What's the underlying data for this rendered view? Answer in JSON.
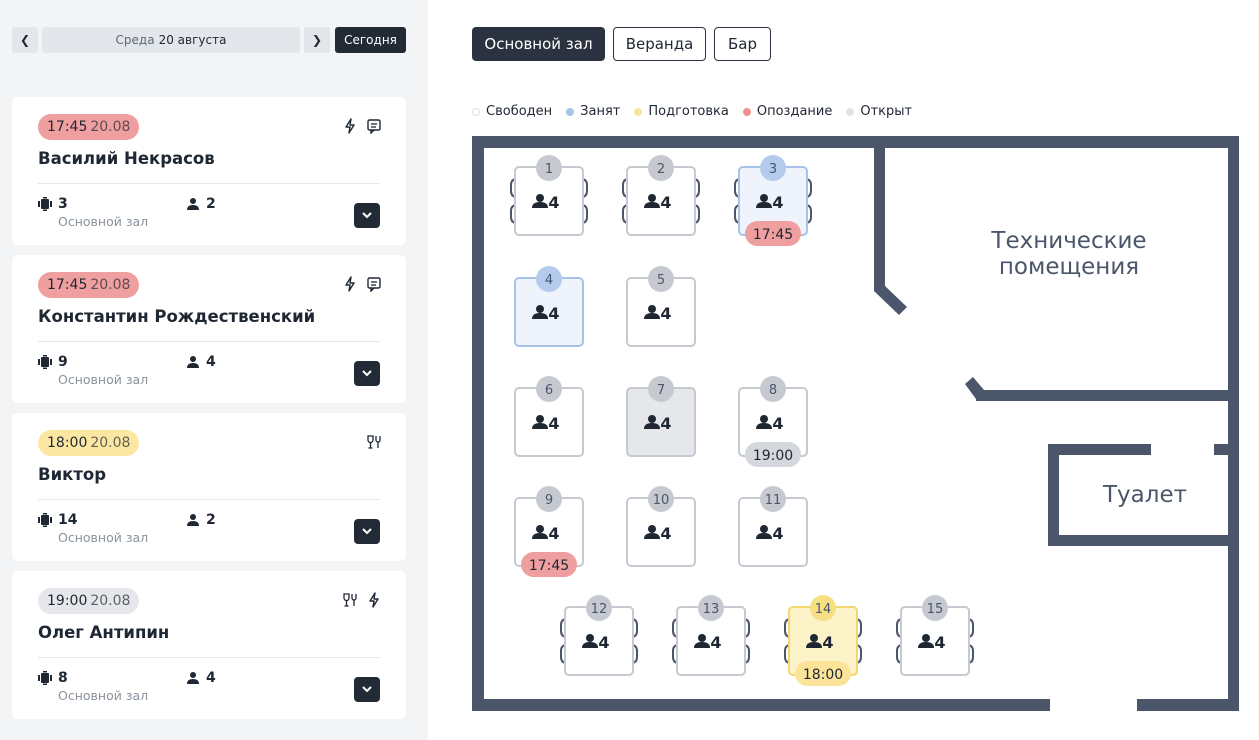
{
  "date_nav": {
    "prev_icon": "chevron-left-icon",
    "weekday": "Среда",
    "date": "20 августа",
    "next_icon": "chevron-right-icon",
    "today_label": "Сегодня"
  },
  "reservations": [
    {
      "time": "17:45",
      "date": "20.08",
      "status": "late",
      "name": "Василий Некрасов",
      "table": "3",
      "hall": "Основной зал",
      "guests": "2",
      "icons": [
        "bolt-icon",
        "comment-icon"
      ]
    },
    {
      "time": "17:45",
      "date": "20.08",
      "status": "late",
      "name": "Константин Рождественский",
      "table": "9",
      "hall": "Основной зал",
      "guests": "4",
      "icons": [
        "bolt-icon",
        "comment-icon"
      ]
    },
    {
      "time": "18:00",
      "date": "20.08",
      "status": "preparing",
      "name": "Виктор",
      "table": "14",
      "hall": "Основной зал",
      "guests": "2",
      "icons": [
        "wine-glass-icon"
      ]
    },
    {
      "time": "19:00",
      "date": "20.08",
      "status": "open",
      "name": "Олег Антипин",
      "table": "8",
      "hall": "Основной зал",
      "guests": "4",
      "icons": [
        "wine-glass-icon",
        "bolt-icon"
      ]
    }
  ],
  "hall_tabs": [
    {
      "label": "Основной зал",
      "active": true
    },
    {
      "label": "Веранда",
      "active": false
    },
    {
      "label": "Бар",
      "active": false
    }
  ],
  "legend": [
    {
      "label": "Свободен",
      "color": "#ffffff"
    },
    {
      "label": "Занят",
      "color": "#a9c2ea"
    },
    {
      "label": "Подготовка",
      "color": "#fbe49a"
    },
    {
      "label": "Опоздание",
      "color": "#ef8f8f"
    },
    {
      "label": "Открыт",
      "color": "#e2e4e8"
    }
  ],
  "rooms": {
    "technical": "Технические помещения",
    "toilet": "Туалет"
  },
  "tables": [
    {
      "number": "1",
      "seats": "4",
      "status": "free",
      "chairs": true
    },
    {
      "number": "2",
      "seats": "4",
      "status": "free",
      "chairs": true
    },
    {
      "number": "3",
      "seats": "4",
      "status": "occupied",
      "chairs": true,
      "reservation_time": "17:45",
      "reservation_status": "late"
    },
    {
      "number": "4",
      "seats": "4",
      "status": "occupied",
      "chairs": false
    },
    {
      "number": "5",
      "seats": "4",
      "status": "free",
      "chairs": false
    },
    {
      "number": "6",
      "seats": "4",
      "status": "free",
      "chairs": false
    },
    {
      "number": "7",
      "seats": "4",
      "status": "open",
      "chairs": false
    },
    {
      "number": "8",
      "seats": "4",
      "status": "free",
      "chairs": false,
      "reservation_time": "19:00",
      "reservation_status": "open"
    },
    {
      "number": "9",
      "seats": "4",
      "status": "free",
      "chairs": false,
      "reservation_time": "17:45",
      "reservation_status": "late"
    },
    {
      "number": "10",
      "seats": "4",
      "status": "free",
      "chairs": false
    },
    {
      "number": "11",
      "seats": "4",
      "status": "free",
      "chairs": false
    },
    {
      "number": "12",
      "seats": "4",
      "status": "free",
      "chairs": true
    },
    {
      "number": "13",
      "seats": "4",
      "status": "free",
      "chairs": true
    },
    {
      "number": "14",
      "seats": "4",
      "status": "preparing",
      "chairs": true,
      "reservation_time": "18:00",
      "reservation_status": "preparing"
    },
    {
      "number": "15",
      "seats": "4",
      "status": "free",
      "chairs": true
    }
  ],
  "colors": {
    "dark": "#222a36",
    "wall": "#4b566a",
    "late": "#ef9f9f",
    "preparing": "#fbe7a1",
    "open": "#e5e7eb",
    "occupied": "#c2d3f0"
  }
}
